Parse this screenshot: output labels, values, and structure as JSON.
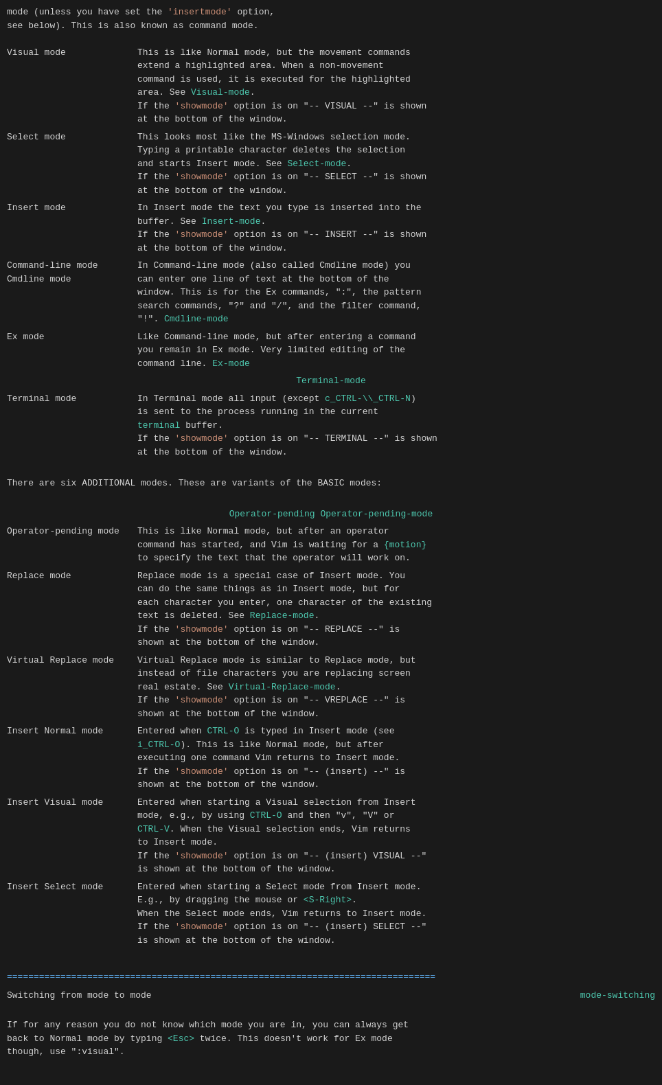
{
  "intro_line1": "mode (unless you have set the ",
  "intro_insertmode": "'insertmode'",
  "intro_line1b": " option,",
  "intro_line2": "see below).  This is also known as command mode.",
  "modes": [
    {
      "name": "Visual mode",
      "desc_parts": [
        {
          "text": "This is like Normal mode, but the movement commands\nextend a highlighted area.  When a non-movement\ncommand is used, it is executed for the highlighted\narea.  See "
        },
        {
          "link": "Visual-mode",
          "type": "cyan"
        },
        {
          "text": ".\nIf the "
        },
        {
          "string": "'showmode'"
        },
        {
          "text": " option is on \"-- VISUAL --\" is shown\nat the bottom of the window."
        }
      ]
    },
    {
      "name": "Select mode",
      "desc_parts": [
        {
          "text": "This looks most like the MS-Windows selection mode.\nTyping a printable character deletes the selection\nand starts Insert mode.  See "
        },
        {
          "link": "Select-mode",
          "type": "cyan"
        },
        {
          "text": ".\nIf the "
        },
        {
          "string": "'showmode'"
        },
        {
          "text": " option is on \"-- SELECT --\" is shown\nat the bottom of the window."
        }
      ]
    },
    {
      "name": "Insert mode",
      "desc_parts": [
        {
          "text": "In Insert mode the text you type is inserted into the\nbuffer.  See "
        },
        {
          "link": "Insert-mode",
          "type": "cyan"
        },
        {
          "text": ".\nIf the "
        },
        {
          "string": "'showmode'"
        },
        {
          "text": " option is on \"-- INSERT --\" is shown\nat the bottom of the window."
        }
      ]
    },
    {
      "name": "Command-line mode\nCmdline mode",
      "desc_parts": [
        {
          "text": "In Command-line mode (also called Cmdline mode) you\ncan enter one line of text at the bottom of the\nwindow.  This is for the Ex commands, \":\", the pattern\nsearch commands, \"?\" and \"/\", and the filter command,\n\"!\".  "
        },
        {
          "link": "Cmdline-mode",
          "type": "cyan"
        }
      ]
    },
    {
      "name": "Ex mode",
      "desc_parts": [
        {
          "text": "Like Command-line mode, but after entering a command\nyou remain in Ex mode.  Very limited editing of the\ncommand line.  "
        },
        {
          "link": "Ex-mode",
          "type": "cyan"
        }
      ]
    }
  ],
  "terminal_header": "Terminal-mode",
  "terminal_name": "Terminal mode",
  "terminal_desc_pre": "In Terminal mode all input (except ",
  "terminal_ctrl": "c_CTRL-\\_CTRL-N",
  "terminal_desc_mid": ")\nis sent to the process running in the current\n",
  "terminal_link": "terminal",
  "terminal_desc_post": " buffer.\nIf the ",
  "terminal_showmode": "'showmode'",
  "terminal_desc_end": " option is on \"-- TERMINAL --\" is shown\nat the bottom of the window.",
  "additional_modes_text": "There are six ADDITIONAL modes.  These are variants of the BASIC modes:",
  "op_pending_header": "Operator-pending Operator-pending-mode",
  "op_pending_name": "Operator-pending mode",
  "op_pending_desc_pre": "This is like Normal mode, but after an operator\ncommand has started, and Vim is waiting for a ",
  "op_pending_motion": "{motion}",
  "op_pending_desc_post": "\nto specify the text that the operator will work on.",
  "additional": [
    {
      "name": "Replace mode",
      "desc_parts": [
        {
          "text": "Replace mode is a special case of Insert mode.  You\ncan do the same things as in Insert mode, but for\neach character you enter, one character of the existing\ntext is deleted.  See "
        },
        {
          "link": "Replace-mode",
          "type": "cyan"
        },
        {
          "text": ".\nIf the "
        },
        {
          "string": "'showmode'"
        },
        {
          "text": " option is on \"-- REPLACE --\" is\nshown at the bottom of the window."
        }
      ]
    },
    {
      "name": "Virtual Replace mode",
      "desc_parts": [
        {
          "text": "Virtual Replace mode is similar to Replace mode, but\ninstead of file characters you are replacing screen\nreal estate.  See "
        },
        {
          "link": "Virtual-Replace-mode",
          "type": "cyan"
        },
        {
          "text": ".\nIf the "
        },
        {
          "string": "'showmode'"
        },
        {
          "text": " option is on \"-- VREPLACE --\" is\nshown at the bottom of the window."
        }
      ]
    },
    {
      "name": "Insert Normal mode",
      "desc_parts": [
        {
          "text": "Entered when "
        },
        {
          "link": "CTRL-O",
          "type": "cyan"
        },
        {
          "text": " is typed in Insert mode (see\n"
        },
        {
          "link": "i_CTRL-O",
          "type": "cyan"
        },
        {
          "text": ").  This is like Normal mode, but after\nexecuting one command Vim returns to Insert mode.\nIf the "
        },
        {
          "string": "'showmode'"
        },
        {
          "text": " option is on \"-- (insert) --\" is\nshown at the bottom of the window."
        }
      ]
    },
    {
      "name": "Insert Visual mode",
      "desc_parts": [
        {
          "text": "Entered when starting a Visual selection from Insert\nmode, e.g., by using "
        },
        {
          "link": "CTRL-O",
          "type": "cyan"
        },
        {
          "text": " and then \"v\", \"V\" or\n"
        },
        {
          "link": "CTRL-V",
          "type": "cyan"
        },
        {
          "text": ".  When the Visual selection ends, Vim returns\nto Insert mode.\nIf the "
        },
        {
          "string": "'showmode'"
        },
        {
          "text": " option is on \"-- (insert) VISUAL --\"\nis shown at the bottom of the window."
        }
      ]
    },
    {
      "name": "Insert Select mode",
      "desc_parts": [
        {
          "text": "Entered when starting a Select mode from Insert mode.\nE.g., by dragging the mouse or "
        },
        {
          "link": "<S-Right>",
          "type": "cyan"
        },
        {
          "text": ".\nWhen the Select mode ends, Vim returns to Insert mode.\nIf the "
        },
        {
          "string": "'showmode'"
        },
        {
          "text": " option is on \"-- (insert) SELECT --\"\nis shown at the bottom of the window."
        }
      ]
    }
  ],
  "divider": "================================================================================",
  "switching_label": "Switching from mode to mode",
  "mode_switching_link": "mode-switching",
  "bottom_text_pre": "If for any reason you do not know which mode you are in, you can always get\nback to Normal mode by typing ",
  "bottom_esc": "<Esc>",
  "bottom_text_mid": " twice.  This doesn't work for Ex mode\nthough, use \":visual\"."
}
